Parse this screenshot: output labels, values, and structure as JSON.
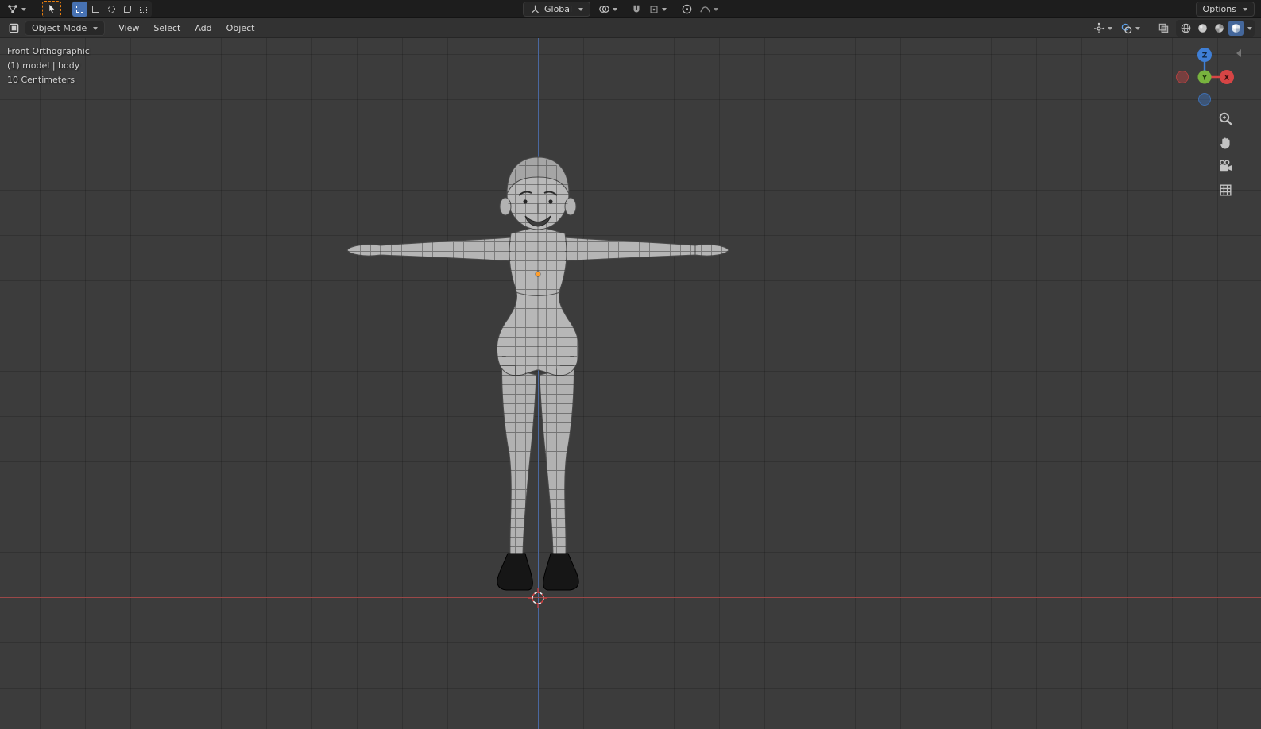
{
  "topbar": {
    "orientation_label": "Global",
    "options_label": "Options"
  },
  "header": {
    "mode_label": "Object Mode",
    "menus": [
      {
        "label": "View"
      },
      {
        "label": "Select"
      },
      {
        "label": "Add"
      },
      {
        "label": "Object"
      }
    ]
  },
  "viewport": {
    "view_label": "Front Orthographic",
    "object_label": "(1) model | body",
    "scale_label": "10 Centimeters"
  },
  "gizmo": {
    "z_label": "Z",
    "y_label": "Y",
    "x_label": "X"
  },
  "colors": {
    "accent_orange": "#e87d0d",
    "active_blue": "#4772b3",
    "axis_x_red": "#9a4848",
    "axis_z_blue": "#4a68a0",
    "gizmo_x": "#d64545",
    "gizmo_y": "#78b33e",
    "gizmo_z": "#3f7fd6",
    "topbar_bg": "#1d1d1d",
    "header_bg": "#323232",
    "viewport_bg": "#3c3c3c"
  },
  "icons": {
    "editor_type": "node-graph-icon",
    "active_tool": "select-cursor-icon",
    "orientation": "axes-icon",
    "pivot": "two-circles-icon",
    "snap": "magnet-icon",
    "proportional": "circle-dot-icon",
    "falloff": "curve-icon",
    "show_gizmos": "gizmo-icon",
    "overlays": "overlays-icon",
    "shading": [
      "wireframe-sphere-icon",
      "solid-sphere-icon",
      "material-sphere-icon",
      "rendered-sphere-icon"
    ],
    "nav": [
      "zoom-icon",
      "pan-hand-icon",
      "camera-icon",
      "grid-ortho-icon"
    ]
  }
}
